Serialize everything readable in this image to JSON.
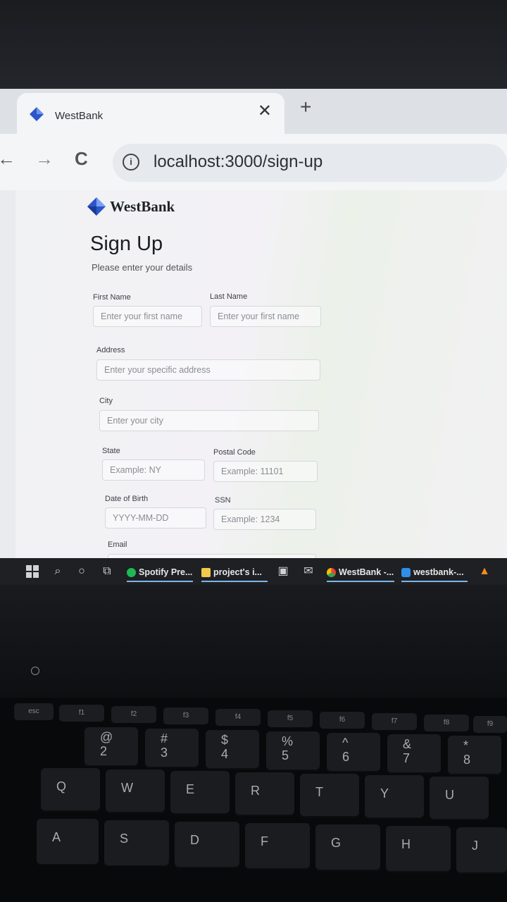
{
  "browser": {
    "tab_title": "WestBank",
    "close_symbol": "✕",
    "new_tab_symbol": "+",
    "url": "localhost:3000/sign-up",
    "back_symbol": "←",
    "forward_symbol": "→",
    "reload_symbol": "C",
    "info_symbol": "i"
  },
  "brand": {
    "name": "WestBank",
    "color": "#2d56c8"
  },
  "form": {
    "title": "Sign Up",
    "subtitle": "Please enter your details",
    "first_name": {
      "label": "First Name",
      "placeholder": "Enter your first name"
    },
    "last_name": {
      "label": "Last Name",
      "placeholder": "Enter your first name"
    },
    "address": {
      "label": "Address",
      "placeholder": "Enter your specific address"
    },
    "city": {
      "label": "City",
      "placeholder": "Enter your city"
    },
    "state": {
      "label": "State",
      "placeholder": "Example: NY"
    },
    "postal_code": {
      "label": "Postal Code",
      "placeholder": "Example: 11101"
    },
    "dob": {
      "label": "Date of Birth",
      "placeholder": "YYYY-MM-DD"
    },
    "ssn": {
      "label": "SSN",
      "placeholder": "Example: 1234"
    },
    "email": {
      "label": "Email"
    }
  },
  "taskbar": {
    "apps": [
      {
        "label": "Spotify Pre...",
        "icon": "spotify-icon",
        "color": "#1db954"
      },
      {
        "label": "project's i...",
        "icon": "folder-icon",
        "color": "#f2c94c"
      },
      {
        "label": "WestBank -...",
        "icon": "chrome-icon",
        "color": "#e94235"
      },
      {
        "label": "westbank-...",
        "icon": "vscode-icon",
        "color": "#2f8ee6"
      }
    ]
  },
  "keyboard": {
    "fkeys": [
      "esc",
      "f1",
      "f2",
      "f3",
      "f4",
      "f5",
      "f6",
      "f7",
      "f8",
      "f9"
    ],
    "row_numbers": [
      "2",
      "3",
      "4",
      "5",
      "6",
      "7",
      "8"
    ],
    "row_number_symbols": [
      "@",
      "#",
      "$",
      "%",
      "^",
      "&",
      "*"
    ],
    "row_qwerty": [
      "Q",
      "W",
      "E",
      "R",
      "T",
      "Y",
      "U"
    ],
    "row_home": [
      "A",
      "S",
      "D",
      "F",
      "G",
      "H",
      "J"
    ]
  }
}
